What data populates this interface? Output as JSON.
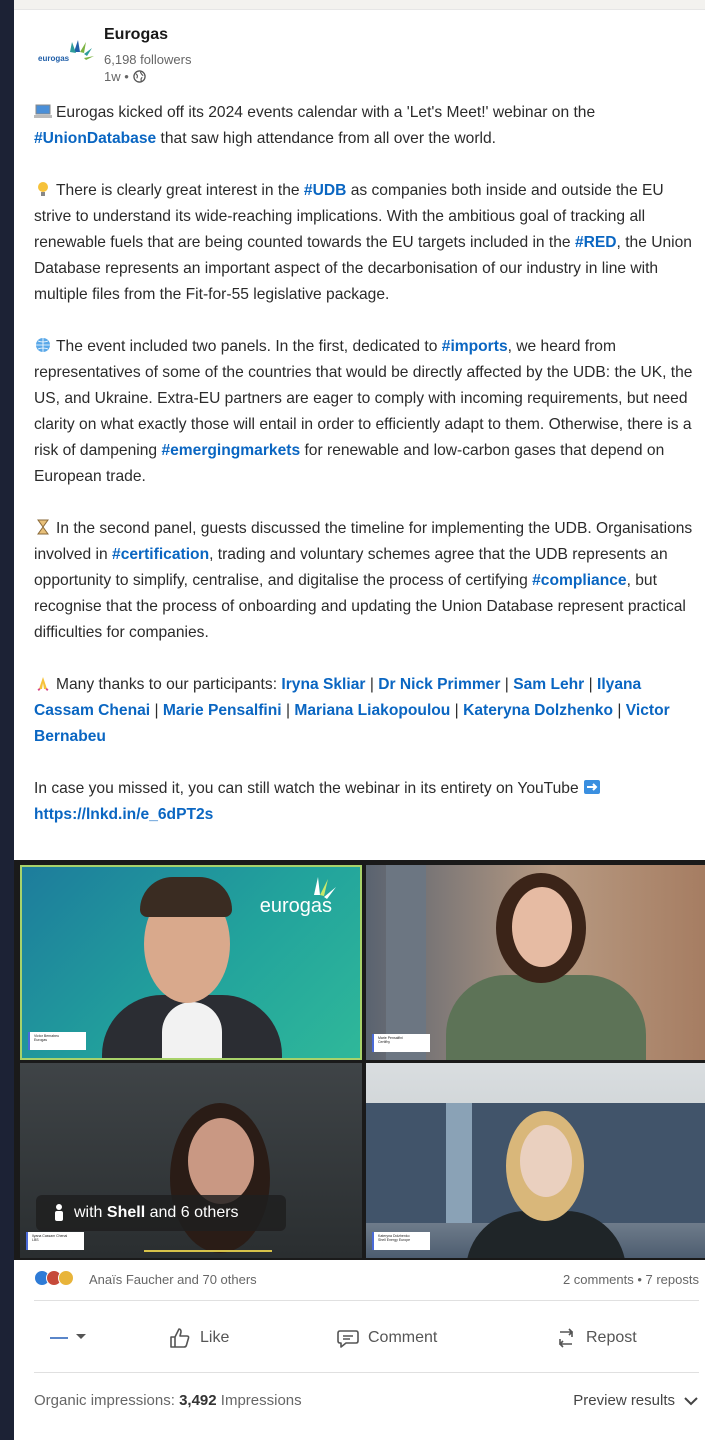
{
  "post": {
    "author": "Eurogas",
    "logo_text": "eurogas",
    "followers": "6,198 followers",
    "time": "1w •",
    "paragraphs": {
      "p1_a": "Eurogas kicked off its 2024 events calendar with a 'Let's Meet!' webinar on the",
      "p1_tag": "#UnionDatabase",
      "p1_b": "that saw high attendance from all over the world.",
      "p2_a": "There is clearly great interest in the",
      "p2_tag1": "#UDB",
      "p2_b": "as companies both inside and outside the EU strive to understand its wide-reaching implications. With the ambitious goal of tracking all renewable fuels that are being counted towards the EU targets included in the",
      "p2_tag2": "#RED",
      "p2_c": ", the Union Database represents an important aspect of the decarbonisation of our industry in line with multiple files from the Fit-for-55 legislative package.",
      "p3_a": "The event included two panels. In the first, dedicated to",
      "p3_tag1": "#imports",
      "p3_b": ", we heard from representatives of some of the countries that would be directly affected by the UDB: the UK, the US, and Ukraine. Extra-EU partners are eager to comply with incoming requirements, but need clarity on what exactly those will entail in order to efficiently adapt to them. Otherwise, there is a risk of dampening",
      "p3_tag2": "#emergingmarkets",
      "p3_c": "for renewable and low-carbon gases that depend on European trade.",
      "p4_a": "In the second panel, guests discussed the timeline for implementing the UDB. Organisations involved in",
      "p4_tag1": "#certification",
      "p4_b": ", trading and voluntary schemes agree that the UDB represents an opportunity to simplify, centralise, and digitalise the process of certifying",
      "p4_tag2": "#compliance",
      "p4_c": ", but recognise that the process of onboarding and updating the Union Database represent practical difficulties for companies.",
      "p5_a": "Many thanks to our participants:",
      "p5_m1": "Iryna Skliar",
      "p5_m2": "Dr Nick Primmer",
      "p5_m3": "Sam Lehr",
      "p5_m4": "Ilyana Cassam Chenai",
      "p5_m5": "Marie Pensalfini",
      "p5_m6": "Mariana Liakopoulou",
      "p5_m7": "Kateryna Dolzhenko",
      "p5_m8": "Victor Bernabeu",
      "sep": "|",
      "p6_a": "In case you missed it, you can still watch the webinar in its entirety on YouTube",
      "p6_link": "https://lnkd.in/e_6dPT2s"
    }
  },
  "media": {
    "tile1_logo": "eurogas",
    "tile1_name": "Victor Bernabeu",
    "tile1_org": "Eurogas",
    "tile2_name": "Marie Pensalfini",
    "tile2_org": "Certifhy",
    "tile3_name": "Ilyana Cassam Chenai",
    "tile3_org": "LBS",
    "tile4_name": "Kateryna Dolzhenko",
    "tile4_org": "Shell Energy Europe",
    "tag_prefix": "with",
    "tag_company": "Shell",
    "tag_suffix": "and 6 others"
  },
  "social": {
    "reactions_text": "Anaïs Faucher and 70 others",
    "counts": "2 comments • 7 reposts"
  },
  "actions": {
    "like": "Like",
    "comment": "Comment",
    "repost": "Repost"
  },
  "stats": {
    "label": "Organic impressions:",
    "value": "3,492",
    "unit": "Impressions",
    "preview": "Preview results"
  },
  "colors": {
    "link": "#0a66c2",
    "frame": "#1c2235"
  },
  "icons": [
    "globe-icon",
    "laptop-emoji-icon",
    "lightbulb-emoji-icon",
    "globe-emoji-icon",
    "hourglass-emoji-icon",
    "pray-emoji-icon",
    "arrow-right-emoji-icon",
    "like-icon",
    "comment-icon",
    "repost-icon",
    "chevron-down-icon"
  ]
}
